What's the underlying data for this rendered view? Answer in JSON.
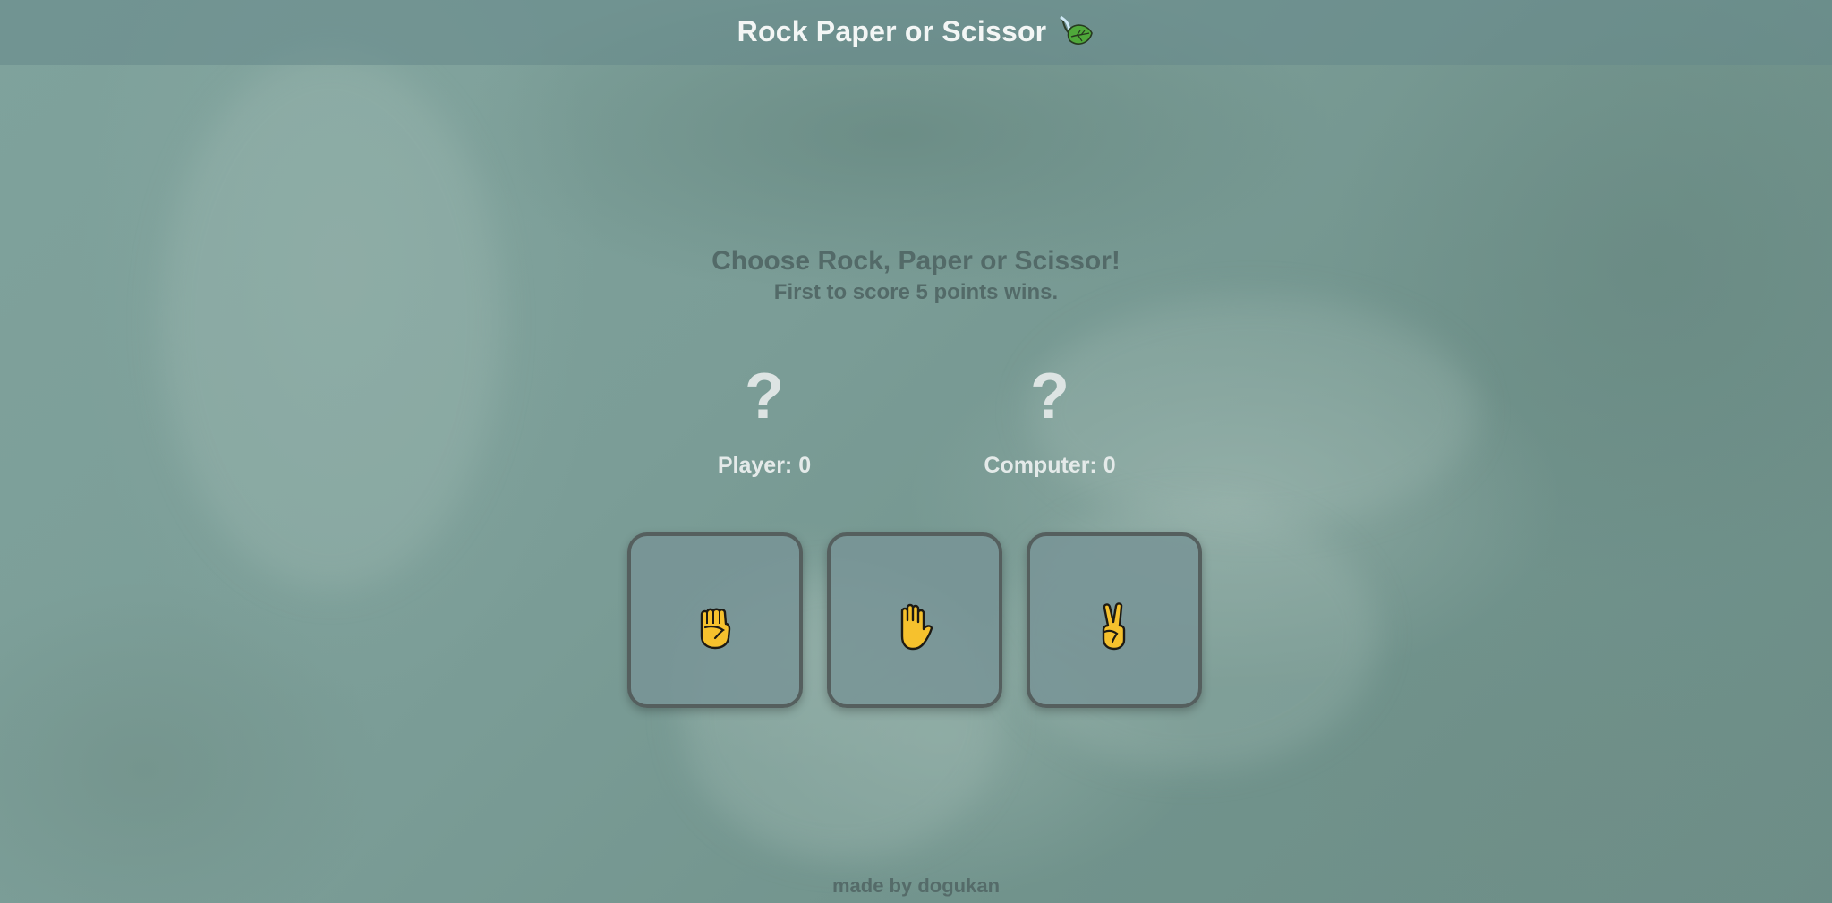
{
  "header": {
    "title": "Rock Paper or Scissor",
    "logo_icon": "leaf-icon"
  },
  "instructions": {
    "heading": "Choose Rock, Paper or Scissor!",
    "subheading": "First to score 5 points wins."
  },
  "scoreboard": {
    "player": {
      "sign": "?",
      "label": "Player: 0",
      "score": 0
    },
    "computer": {
      "sign": "?",
      "label": "Computer: 0",
      "score": 0
    }
  },
  "choices": [
    {
      "name": "rock",
      "icon": "raised-fist-icon"
    },
    {
      "name": "paper",
      "icon": "raised-hand-icon"
    },
    {
      "name": "scissor",
      "icon": "victory-hand-icon"
    }
  ],
  "footer": {
    "credit": "made by dogukan"
  },
  "colors": {
    "title": "#f3f6f5",
    "instructions": "#536a68",
    "score": "#e4eae9",
    "button_border": "#555f5e",
    "emoji": "#f6c12d"
  }
}
